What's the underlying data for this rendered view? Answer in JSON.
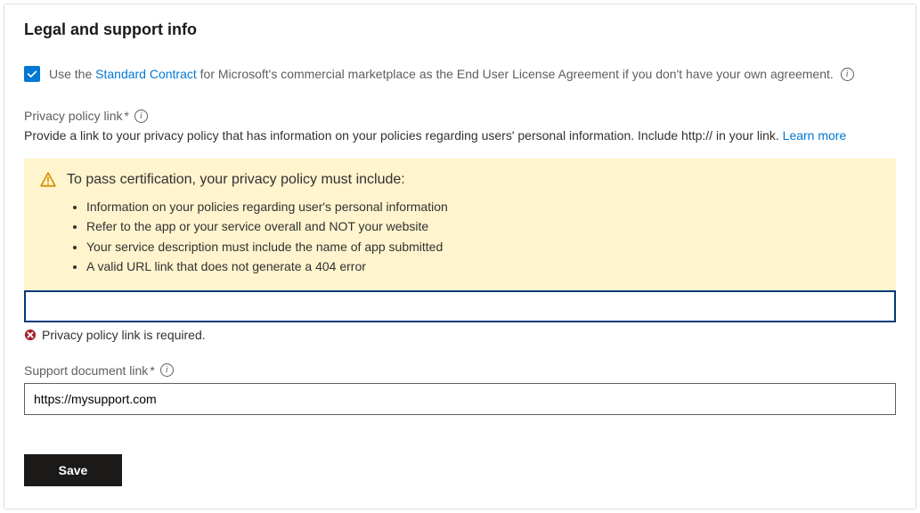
{
  "heading": "Legal and support info",
  "checkbox": {
    "label_prefix": "Use the ",
    "label_link": "Standard Contract",
    "label_suffix": " for Microsoft's commercial marketplace as the End User License Agreement if you don't have your own agreement."
  },
  "privacy": {
    "label": "Privacy policy link",
    "required_mark": "*",
    "description_prefix": "Provide a link to your privacy policy that has information on your policies regarding users' personal information. Include http:// in your link. ",
    "learn_more": "Learn more",
    "error_message": "Privacy policy link is required.",
    "value": ""
  },
  "warning": {
    "title": "To pass certification, your privacy policy must include:",
    "items": [
      "Information on your policies regarding user's personal information",
      "Refer to the app or your service overall and NOT your website",
      "Your service description must include the name of app submitted",
      "A valid URL link that does not generate a 404 error"
    ]
  },
  "support": {
    "label": "Support document link",
    "required_mark": "*",
    "value": "https://mysupport.com"
  },
  "save_button": "Save"
}
